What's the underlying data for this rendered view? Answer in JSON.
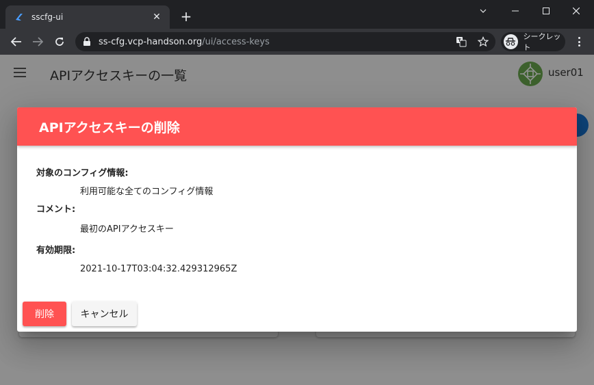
{
  "browser": {
    "tab_title": "sscfg-ui",
    "url_host": "ss-cfg.vcp-handson.org",
    "url_path": "/ui/access-keys",
    "incognito_label": "シークレット"
  },
  "app": {
    "title": "APIアクセスキーの一覧",
    "user_name": "user01"
  },
  "dialog": {
    "title": "APIアクセスキーの削除",
    "fields": [
      {
        "label": "対象のコンフィグ情報:",
        "value": "利用可能な全てのコンフィグ情報"
      },
      {
        "label": "コメント:",
        "value": "最初のAPIアクセスキー"
      },
      {
        "label": "有効期限:",
        "value": "2021-10-17T03:04:32.429312965Z"
      }
    ],
    "delete_label": "削除",
    "cancel_label": "キャンセル"
  },
  "colors": {
    "accent": "#ff5252",
    "chrome_dark": "#202124",
    "chrome_toolbar": "#35363a",
    "fab": "#1976d2"
  }
}
